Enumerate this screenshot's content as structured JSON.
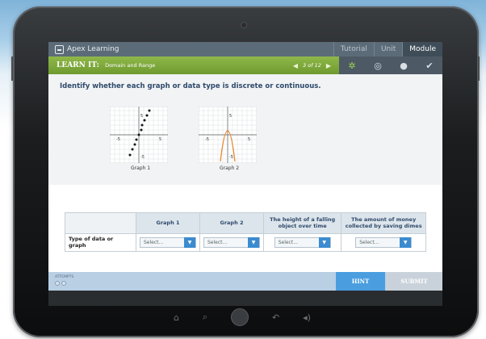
{
  "app": {
    "brand": "Apex Learning",
    "tabs": [
      "Tutorial",
      "Unit",
      "Module"
    ],
    "active_tab": "Module"
  },
  "learn": {
    "prefix": "LEARN IT:",
    "title": "Domain and Range",
    "page": "3 of 12"
  },
  "prompt": "Identify whether each graph or data type is discrete or continuous.",
  "graphs": [
    {
      "label": "Graph 1",
      "ticks": [
        "5",
        "-5",
        "5",
        "-5"
      ]
    },
    {
      "label": "Graph 2",
      "ticks": [
        "5",
        "-5",
        "5",
        "-5"
      ]
    }
  ],
  "table": {
    "headers": [
      "Graph 1",
      "Graph 2",
      "The height of a falling object over time",
      "The amount of money collected by saving dimes"
    ],
    "row_label": "Type of data or graph",
    "select_placeholder": "Select..."
  },
  "footer": {
    "attempts_label": "ATTEMPTS",
    "hint": "HINT",
    "submit": "SUBMIT"
  },
  "colors": {
    "accent_green": "#7aa638",
    "hint_blue": "#4a9ee0",
    "curve_orange": "#e8862a"
  },
  "icons": [
    "gear-icon",
    "target-icon",
    "circle-icon",
    "check-icon",
    "home-icon",
    "search-icon",
    "back-icon",
    "volume-icon"
  ]
}
